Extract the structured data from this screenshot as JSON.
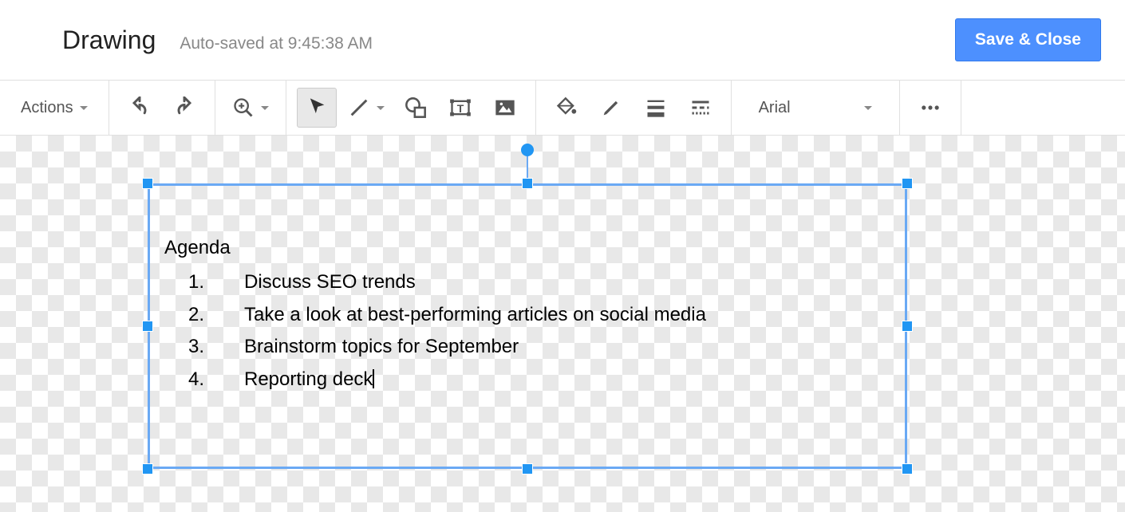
{
  "header": {
    "title": "Drawing",
    "save_status": "Auto-saved at 9:45:38 AM",
    "save_close": "Save & Close"
  },
  "toolbar": {
    "actions_label": "Actions",
    "font_name": "Arial"
  },
  "textbox": {
    "heading": "Agenda",
    "items": [
      {
        "num": "1.",
        "text": "Discuss SEO trends"
      },
      {
        "num": "2.",
        "text": "Take a look at best-performing articles on social media"
      },
      {
        "num": "3.",
        "text": "Brainstorm topics for September"
      },
      {
        "num": "4.",
        "text": "Reporting deck"
      }
    ]
  }
}
